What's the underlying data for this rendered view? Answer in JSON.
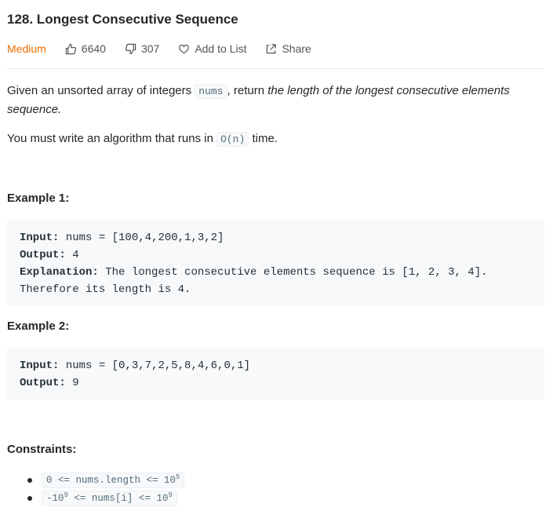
{
  "problem": {
    "title": "128. Longest Consecutive Sequence",
    "difficulty": "Medium",
    "likes": "6640",
    "dislikes": "307",
    "add_to_list": "Add to List",
    "share": "Share"
  },
  "description": {
    "p1_a": "Given an unsorted array of integers ",
    "p1_code": "nums",
    "p1_b": ", return ",
    "p1_em": "the length of the longest consecutive elements sequence.",
    "p2_a": "You must write an algorithm that runs in ",
    "p2_code": "O(n)",
    "p2_b": " time."
  },
  "examples": [
    {
      "title": "Example 1:",
      "input_label": "Input:",
      "input": " nums = [100,4,200,1,3,2]",
      "output_label": "Output:",
      "output": " 4",
      "explanation_label": "Explanation:",
      "explanation": " The longest consecutive elements sequence is [1, 2, 3, 4].",
      "explanation_2": "Therefore its length is 4."
    },
    {
      "title": "Example 2:",
      "input_label": "Input:",
      "input": " nums = [0,3,7,2,5,8,4,6,0,1]",
      "output_label": "Output:",
      "output": " 9"
    }
  ],
  "constraints": {
    "title": "Constraints:",
    "c1_a": "0 <= nums.length <= 10",
    "c1_sup": "5",
    "c2_pre": "-10",
    "c2_pre_sup": "9",
    "c2_a": " <= nums[i] <= 10",
    "c2_sup": "9"
  },
  "colors": {
    "difficulty": "#ef6c00",
    "code_bg": "#f7f9fa"
  }
}
